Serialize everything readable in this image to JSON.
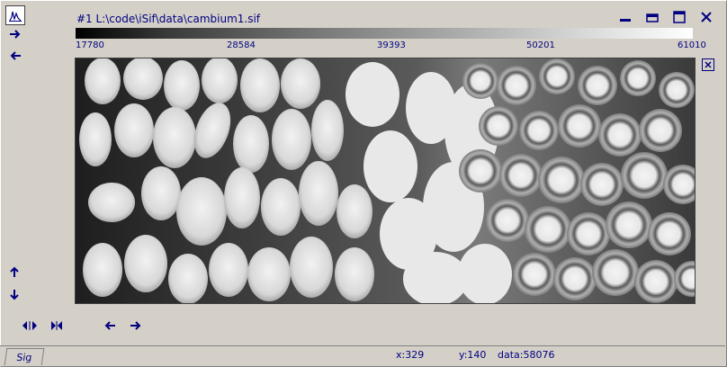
{
  "window": {
    "title": "#1  L:\\code\\iSif\\data\\cambium1.sif"
  },
  "colorbar": {
    "ticks": [
      "17780",
      "28584",
      "39393",
      "50201",
      "61010"
    ]
  },
  "image": {
    "description_icon": "grayscale-image"
  },
  "status": {
    "tab_label": "Sig",
    "x": "x:329",
    "y": "y:140",
    "data": "data:58076"
  },
  "colors": {
    "accent": "#000080",
    "background": "#d4d0c8"
  },
  "icons": {
    "top_left": "histogram-icon",
    "minimize": "minimize-icon",
    "restore": "restore-icon",
    "maximize": "maximize-icon",
    "close": "close-icon"
  }
}
